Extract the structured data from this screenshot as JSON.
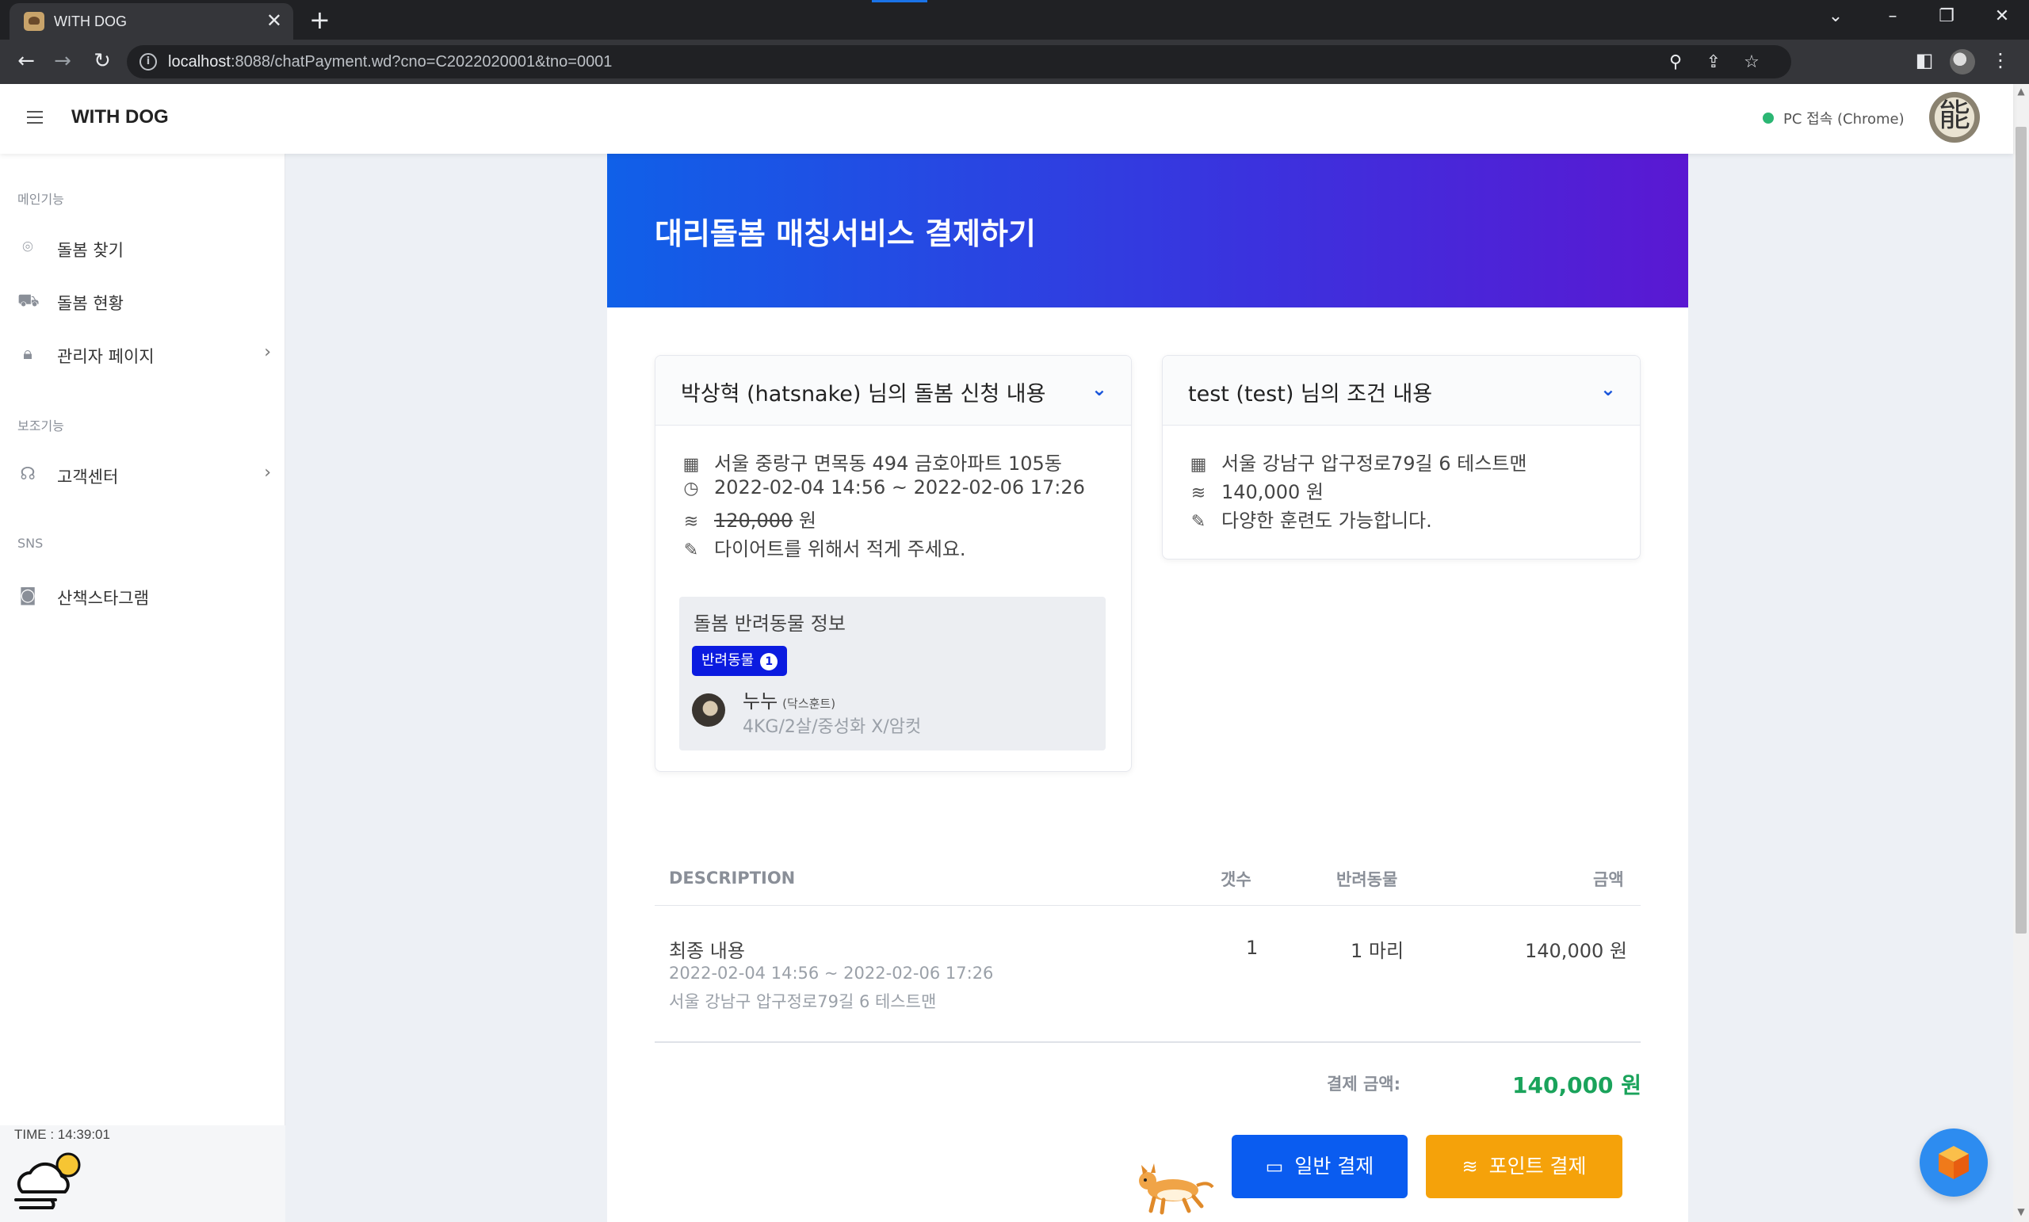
{
  "browser": {
    "tab_title": "WITH DOG",
    "url_host": "localhost",
    "url_rest": ":8088/chatPayment.wd?cno=C2022020001&tno=0001"
  },
  "header": {
    "brand": "WITH DOG",
    "status": "PC 접속 (Chrome)",
    "avatar_text": "能"
  },
  "sidebar": {
    "group_main": "메인기능",
    "group_sub": "보조기능",
    "group_sns": "SNS",
    "items": [
      {
        "label": "돌봄 찾기",
        "icon": "map-pin-icon"
      },
      {
        "label": "돌봄 현황",
        "icon": "cart-icon"
      },
      {
        "label": "관리자 페이지",
        "icon": "lock-icon"
      },
      {
        "label": "고객센터",
        "icon": "headset-icon"
      },
      {
        "label": "산책스타그램",
        "icon": "camera-icon"
      }
    ],
    "time": "TIME : 14:39:01"
  },
  "page": {
    "title": "대리돌봄 매칭서비스 결제하기"
  },
  "request": {
    "title": "박상혁 (hatsnake) 님의 돌봄 신청 내용",
    "address": "서울 중랑구 면목동 494 금호아파트 105동",
    "period": "2022-02-04 14:56 ~ 2022-02-06 17:26",
    "price": "120,000",
    "price_unit": "원",
    "memo": "다이어트를 위해서 적게 주세요.",
    "pet_section_title": "돌봄 반려동물 정보",
    "pet_badge": "반려동물",
    "pet_count": "1",
    "pet_name": "누누",
    "pet_breed": "(닥스훈트)",
    "pet_detail": "4KG/2살/중성화 X/암컷"
  },
  "condition": {
    "title": "test (test) 님의 조건 내용",
    "address": "서울 강남구 압구정로79길 6 테스트맨",
    "price": "140,000 원",
    "memo": "다양한 훈련도 가능합니다."
  },
  "invoice": {
    "col_desc": "DESCRIPTION",
    "col_qty": "갯수",
    "col_pet": "반려동물",
    "col_amount": "금액",
    "row_title": "최종 내용",
    "row_period": "2022-02-04 14:56 ~ 2022-02-06 17:26",
    "row_address": "서울 강남구 압구정로79길 6 테스트맨",
    "row_qty": "1",
    "row_pet": "1 마리",
    "row_amount": "140,000 원",
    "total_label": "결제 금액:",
    "total_value": "140,000 원"
  },
  "buttons": {
    "normal_pay": "일반 결제",
    "point_pay": "포인트 결제"
  },
  "colors": {
    "hero_start": "#1060e8",
    "hero_end": "#5a18d2",
    "normal_btn": "#0a5cf0",
    "point_btn": "#f5a20a",
    "total": "#1aa35b"
  }
}
